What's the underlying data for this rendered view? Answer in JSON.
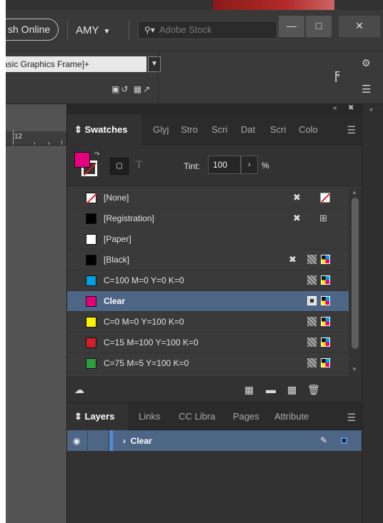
{
  "topbar": {
    "publish_label": "sh Online",
    "user": "AMY",
    "stock_placeholder": "Adobe Stock"
  },
  "controlbar": {
    "object_style": "asic Graphics Frame]+"
  },
  "ruler": {
    "mark": "12"
  },
  "swatches_panel": {
    "tabs": [
      "Swatches",
      "Glyj",
      "Stro",
      "Scri",
      "Dat",
      "Scri",
      "Colo"
    ],
    "tint_label": "Tint:",
    "tint_value": "100",
    "tint_unit": "%",
    "fill_color": "#e6007e",
    "swatches": [
      {
        "name": "[None]",
        "color": "none"
      },
      {
        "name": "[Registration]",
        "color": "#000000"
      },
      {
        "name": "[Paper]",
        "color": "#ffffff"
      },
      {
        "name": "[Black]",
        "color": "#000000"
      },
      {
        "name": "C=100 M=0 Y=0 K=0",
        "color": "#00a0e0"
      },
      {
        "name": "Clear",
        "color": "#e6007e",
        "selected": true
      },
      {
        "name": "C=0 M=0 Y=100 K=0",
        "color": "#fff200"
      },
      {
        "name": "C=15 M=100 Y=100 K=0",
        "color": "#d0202a"
      },
      {
        "name": "C=75 M=5 Y=100 K=0",
        "color": "#2e9e3e"
      }
    ]
  },
  "layers_panel": {
    "tabs": [
      "Layers",
      "Links",
      "CC Libra",
      "Pages",
      "Attribute"
    ],
    "layers": [
      {
        "name": "Clear",
        "color": "#4f8fe0"
      }
    ]
  }
}
